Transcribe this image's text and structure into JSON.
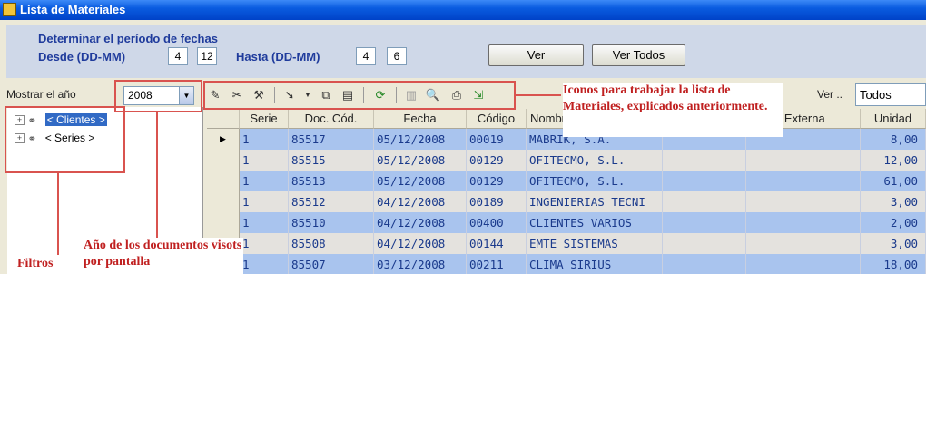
{
  "window": {
    "title": "Lista de Materiales"
  },
  "period": {
    "heading": "Determinar el período de fechas",
    "desde_label": "Desde (DD-MM)",
    "desde_day": "4",
    "desde_month": "12",
    "hasta_label": "Hasta (DD-MM)",
    "hasta_day": "4",
    "hasta_month": "6",
    "ver_button": "Ver",
    "ver_todos_button": "Ver Todos"
  },
  "year": {
    "label": "Mostrar el año",
    "value": "2008"
  },
  "toolbar": {
    "icons": [
      "edit-icon",
      "cut-icon",
      "tools-icon",
      "arrow-icon",
      "dropdown-icon",
      "copy-icon",
      "paste-icon",
      "refresh-icon",
      "columns-icon",
      "preview-icon",
      "print-icon",
      "export-icon"
    ]
  },
  "filter": {
    "label": "Ver ..",
    "value": "Todos"
  },
  "tree": {
    "items": [
      {
        "label": "< Clientes >",
        "selected": true
      },
      {
        "label": "< Series >",
        "selected": false
      }
    ]
  },
  "table": {
    "columns": [
      "Serie",
      "Doc. Cód.",
      "Fecha",
      "Código",
      "Nombre",
      ".Externa",
      "Unidad"
    ],
    "rows": [
      [
        "1",
        "85517",
        "05/12/2008",
        "00019",
        "MABRIK, S.A.",
        "",
        "8,00"
      ],
      [
        "1",
        "85515",
        "05/12/2008",
        "00129",
        "OFITECMO, S.L.",
        "",
        "12,00"
      ],
      [
        "1",
        "85513",
        "05/12/2008",
        "00129",
        "OFITECMO, S.L.",
        "",
        "61,00"
      ],
      [
        "1",
        "85512",
        "04/12/2008",
        "00189",
        "INGENIERIAS TECNI",
        "",
        "3,00"
      ],
      [
        "1",
        "85510",
        "04/12/2008",
        "00400",
        "CLIENTES VARIOS",
        "",
        "2,00"
      ],
      [
        "1",
        "85508",
        "04/12/2008",
        "00144",
        "EMTE SISTEMAS",
        "",
        "3,00"
      ],
      [
        "1",
        "85507",
        "03/12/2008",
        "00211",
        "CLIMA SIRIUS",
        "",
        "18,00"
      ]
    ],
    "row_colors": [
      "#a9c4ee",
      "#e4e2de"
    ]
  },
  "annotations": {
    "icons_note": "Iconos para trabajar la lista de Materiales, explicados anteriormente.",
    "year_note": "Año de los documentos visots por pantalla",
    "filters_note": "Filtros",
    "color": "#c02020"
  }
}
